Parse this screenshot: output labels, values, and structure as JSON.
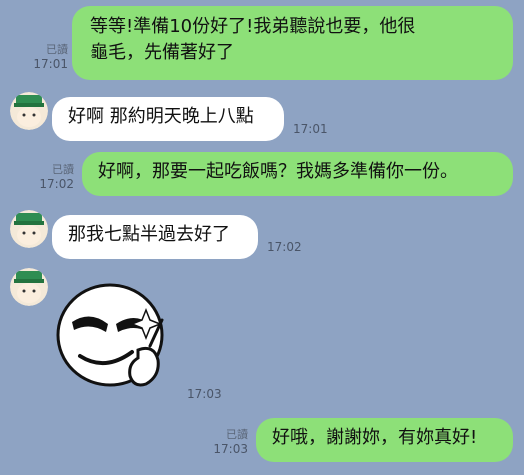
{
  "messages": [
    {
      "text": "等等!準備10份好了!我弟聽說也要，他很龜毛，先備著好了",
      "line1": "等等!準備10份好了!我弟聽說也要，他很",
      "line2": "龜毛，先備著好了",
      "read": "已讀",
      "time": "17:01"
    },
    {
      "text": "好啊 那約明天晚上八點",
      "time": "17:01"
    },
    {
      "text": "好啊，那要一起吃飯嗎？我媽多準備你一份。",
      "read": "已讀",
      "time": "17:02"
    },
    {
      "text": "那我七點半過去好了",
      "time": "17:02"
    },
    {
      "sticker": "smirking-face-sticker",
      "time": "17:03"
    },
    {
      "text": "好哦，謝謝妳，有妳真好!",
      "read": "已讀",
      "time": "17:03"
    }
  ],
  "colors": {
    "background": "#8ea3c3",
    "outgoing": "#8de078",
    "incoming": "#ffffff"
  },
  "icons": {
    "avatar": "green-cap-avatar-icon",
    "sticker": "smirking-face-sticker"
  }
}
